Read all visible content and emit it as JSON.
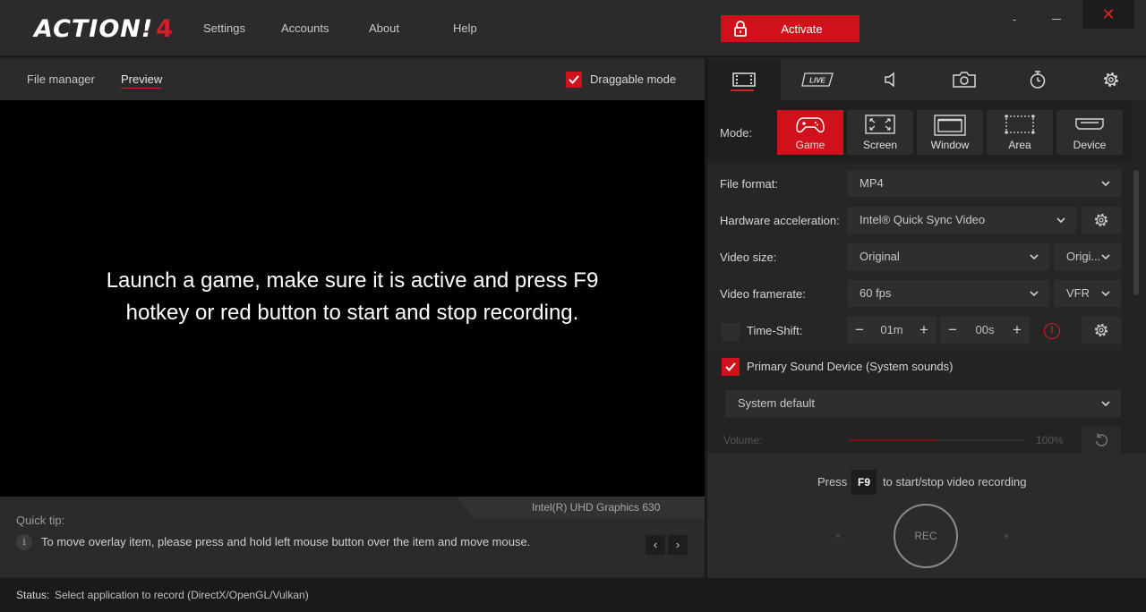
{
  "app": {
    "logo_text": "ACTION!",
    "logo_version": "4"
  },
  "nav": {
    "settings": "Settings",
    "accounts": "Accounts",
    "about": "About",
    "help": "Help"
  },
  "activate_label": "Activate",
  "window_controls": {
    "minimize": "-",
    "close": "✕"
  },
  "left_tabs": {
    "file_manager": "File manager",
    "preview": "Preview",
    "active": "preview"
  },
  "draggable_mode": {
    "label": "Draggable mode",
    "checked": true
  },
  "preview_message": "Launch a game, make sure it is active and press F9\nhotkey or red button to start and stop recording.",
  "gpu_name": "Intel(R) UHD Graphics 630",
  "quick_tip": {
    "title": "Quick tip:",
    "info_glyph": "i",
    "text": "To move overlay item, please press and hold left mouse button over the item and move mouse.",
    "prev": "‹",
    "next": "›"
  },
  "right_tabs": [
    {
      "name": "video-tab",
      "icon": "film-icon",
      "active": true
    },
    {
      "name": "live-tab",
      "icon": "live-icon",
      "active": false
    },
    {
      "name": "audio-tab",
      "icon": "speaker-icon",
      "active": false
    },
    {
      "name": "screenshot-tab",
      "icon": "camera-icon",
      "active": false
    },
    {
      "name": "timer-tab",
      "icon": "stopwatch-icon",
      "active": false
    },
    {
      "name": "settings-tab",
      "icon": "gear-icon",
      "active": false
    }
  ],
  "live_badge": "LIVE",
  "mode": {
    "label": "Mode:",
    "items": [
      {
        "label": "Game",
        "icon": "gamepad-icon",
        "active": true
      },
      {
        "label": "Screen",
        "icon": "screen-icon",
        "active": false
      },
      {
        "label": "Window",
        "icon": "window-icon",
        "active": false
      },
      {
        "label": "Area",
        "icon": "area-icon",
        "active": false
      },
      {
        "label": "Device",
        "icon": "device-icon",
        "active": false
      }
    ]
  },
  "settings": {
    "file_format": {
      "label": "File format:",
      "value": "MP4"
    },
    "hw_accel": {
      "label": "Hardware acceleration:",
      "value": "Intel® Quick Sync Video"
    },
    "video_size": {
      "label": "Video size:",
      "value": "Original",
      "value2": "Origi..."
    },
    "framerate": {
      "label": "Video framerate:",
      "value": "60 fps",
      "value2": "VFR"
    },
    "time_shift": {
      "label": "Time-Shift:",
      "checked": false,
      "minutes": "01m",
      "seconds": "00s",
      "warn_glyph": "!"
    }
  },
  "sound": {
    "primary_label": "Primary Sound Device (System sounds)",
    "checked": true,
    "device": "System default",
    "volume_label": "Volume:",
    "volume_value": "100%",
    "volume_fraction": 0.5
  },
  "recording": {
    "press": "Press",
    "hotkey": "F9",
    "description": "to start/stop video recording",
    "rec_label": "REC"
  },
  "status": {
    "label": "Status:",
    "text": "Select application to record  (DirectX/OpenGL/Vulkan)"
  },
  "colors": {
    "accent": "#d0111b",
    "background": "#232323",
    "panel": "#2b2b2b"
  }
}
